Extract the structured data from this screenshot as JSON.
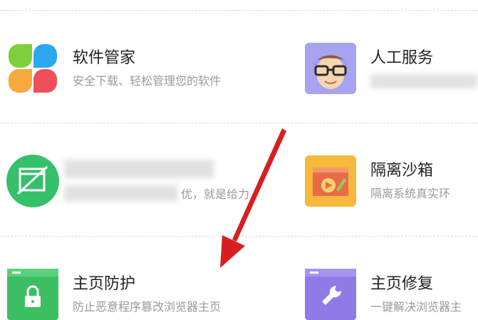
{
  "tools": {
    "software_manager": {
      "name": "软件管家",
      "desc": "安全下载、轻松管理您的软件",
      "icon": "colorful-petals-icon"
    },
    "human_service": {
      "name": "人工服务",
      "desc": "",
      "icon": "customer-service-avatar-icon"
    },
    "blurred_tool": {
      "name": "",
      "desc": "优，就是给力",
      "icon": "green-crossed-window-icon"
    },
    "isolation_sandbox": {
      "name": "隔离沙箱",
      "desc": "隔离系统真实环",
      "icon": "sandbox-icon"
    },
    "homepage_protection": {
      "name": "主页防护",
      "desc": "防止恶意程序篡改浏览器主页",
      "icon": "green-lock-window-icon"
    },
    "homepage_repair": {
      "name": "主页修复",
      "desc": "一键解决浏览器主",
      "icon": "purple-wrench-window-icon"
    }
  },
  "annotation": {
    "arrow_color": "#d71f1f"
  }
}
